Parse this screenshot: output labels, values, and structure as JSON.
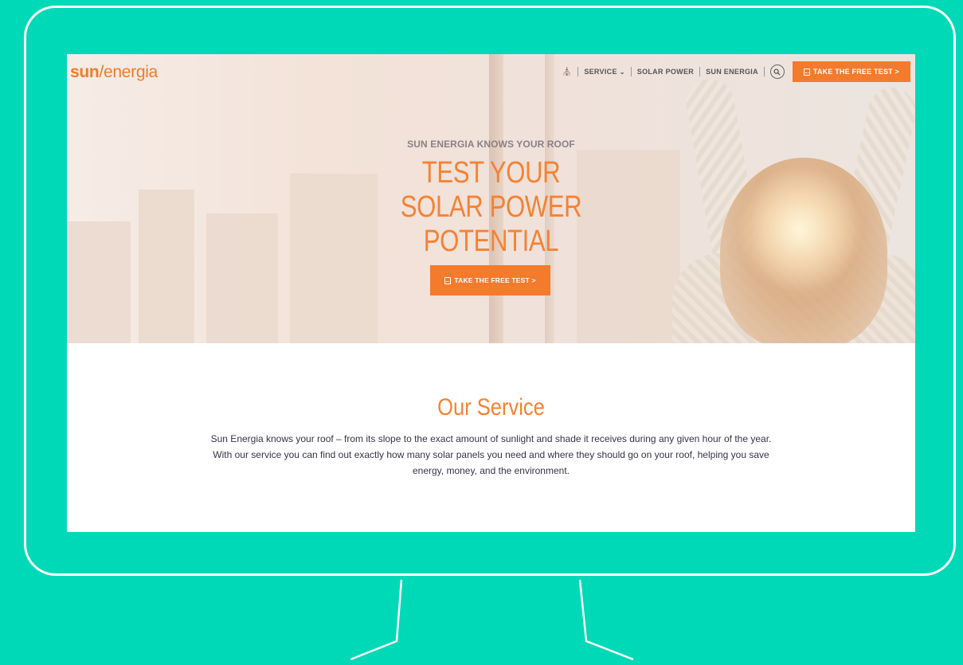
{
  "brand": {
    "logo_sun": "sun",
    "logo_slash": "/",
    "logo_energia": "energia",
    "accent": "#f47a2c",
    "background": "#00d9b8"
  },
  "nav": {
    "home_icon": "home-icon",
    "items": [
      {
        "label": "SERVICE",
        "has_dropdown": true
      },
      {
        "label": "SOLAR POWER"
      },
      {
        "label": "SUN ENERGIA"
      }
    ],
    "search_icon": "search-icon",
    "cta_label": "TAKE THE FREE TEST >"
  },
  "hero": {
    "kicker": "SUN ENERGIA KNOWS YOUR ROOF",
    "headline_lines": [
      "TEST YOUR",
      "SOLAR POWER",
      "POTENTIAL"
    ],
    "button_label": "TAKE THE FREE TEST >"
  },
  "service": {
    "title": "Our Service",
    "text": "Sun Energia knows your roof – from its slope to the exact amount of sunlight and shade it receives during any given hour of the year. With our service you can find out exactly how many solar panels you need and where they should go on your roof, helping you save energy, money, and the environment."
  }
}
